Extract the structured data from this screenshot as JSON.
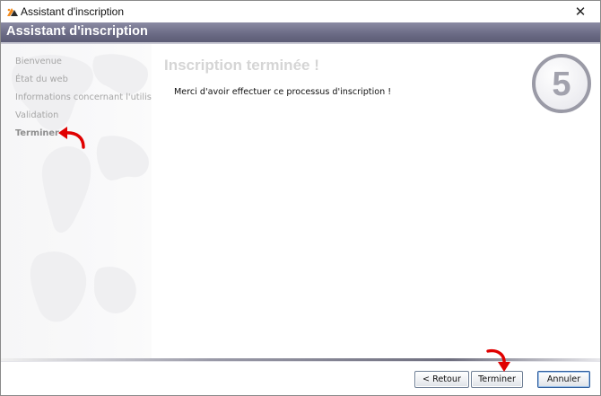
{
  "window": {
    "title": "Assistant d'inscription",
    "close_glyph": "✕"
  },
  "banner": {
    "title": "Assistant d'inscription"
  },
  "steps": [
    {
      "label": "Bienvenue",
      "active": false
    },
    {
      "label": "État du web",
      "active": false
    },
    {
      "label": "Informations concernant l'utilisateur",
      "active": false
    },
    {
      "label": "Validation",
      "active": false
    },
    {
      "label": "Terminer",
      "active": true
    }
  ],
  "content": {
    "title": "Inscription terminée !",
    "message": "Merci d'avoir effectuer ce processus d'inscription !",
    "step_number": "5"
  },
  "buttons": {
    "back": "< Retour",
    "finish": "Terminer",
    "cancel": "Annuler"
  },
  "icons": {
    "app": "app-logo-icon",
    "close": "close-icon",
    "annotation": "red-curved-arrow-icon"
  },
  "colors": {
    "banner": "#6c6c86",
    "annotation_arrow": "#e00000",
    "badge_ring": "#9a9aa6",
    "step_inactive": "#a6a6a6",
    "title_faded": "#d5d5d5"
  }
}
